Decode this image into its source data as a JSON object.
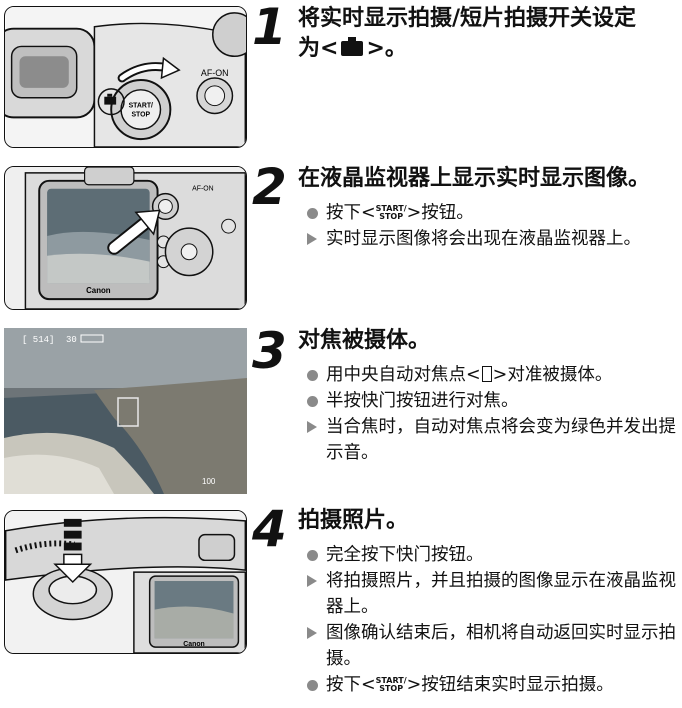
{
  "steps": [
    {
      "number": "1",
      "heading_before": "将实时显示拍摄/短片拍摄开关设定",
      "heading_line2_prefix": "为<",
      "heading_line2_suffix": ">。",
      "heading_icon": "camera-icon",
      "illustration": {
        "button_label_start": "START/",
        "button_label_stop": "STOP",
        "af_on_label": "AF-ON"
      }
    },
    {
      "number": "2",
      "heading": "在液晶监视器上显示实时显示图像。",
      "items": [
        {
          "marker": "dot",
          "before": "按下<",
          "ss_top": "START/",
          "ss_bottom": "STOP",
          "after": ">按钮。"
        },
        {
          "marker": "triangle",
          "text": "实时显示图像将会出现在液晶监视器上。"
        }
      ],
      "illustration": {
        "brand": "Canon",
        "af_on_label": "AF-ON"
      }
    },
    {
      "number": "3",
      "heading": "对焦被摄体。",
      "items": [
        {
          "marker": "dot",
          "before": "用中央自动对焦点<",
          "after": ">对准被摄体。"
        },
        {
          "marker": "dot",
          "text": "半按快门按钮进行对焦。"
        },
        {
          "marker": "triangle",
          "text": "当合焦时，自动对焦点将会变为绿色并发出提示音。"
        }
      ],
      "illustration": {
        "shots_left": "[ 514]",
        "exposure_info": "30",
        "iso": "100"
      }
    },
    {
      "number": "4",
      "heading": "拍摄照片。",
      "items": [
        {
          "marker": "dot",
          "text": "完全按下快门按钮。"
        },
        {
          "marker": "triangle",
          "text": "将拍摄照片，并且拍摄的图像显示在液晶监视器上。"
        },
        {
          "marker": "triangle",
          "text": "图像确认结束后，相机将自动返回实时显示拍摄。"
        },
        {
          "marker": "dot",
          "before": "按下<",
          "ss_top": "START/",
          "ss_bottom": "STOP",
          "after": ">按钮结束实时显示拍摄。"
        }
      ],
      "illustration": {
        "brand": "Canon"
      }
    }
  ],
  "colors": {
    "bullet": "#8a8a8a",
    "text": "#111111"
  }
}
